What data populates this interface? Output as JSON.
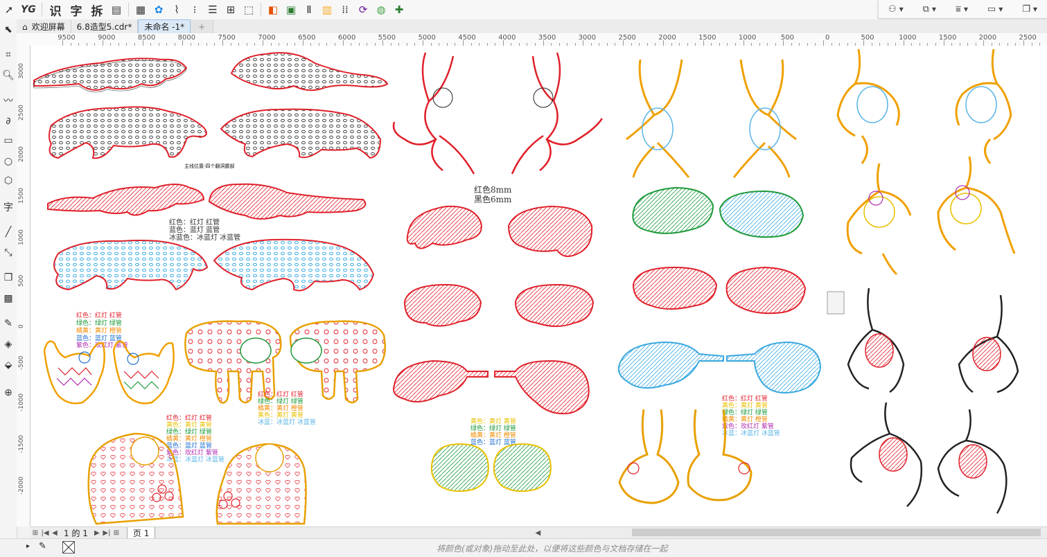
{
  "toolbar": {
    "text_icons": [
      "YG",
      "识",
      "字",
      "拆"
    ],
    "right_panel": [
      "arrange-icon",
      "group-icon",
      "align-icon",
      "display-icon",
      "window-icon"
    ]
  },
  "tabs": {
    "home_label": "欢迎屏幕",
    "doc1": "6.8造型5.cdr*",
    "doc2": "未命名 -1*"
  },
  "ruler": {
    "h_labels": [
      "9500",
      "9000",
      "8500",
      "8000",
      "7500",
      "7000",
      "6500",
      "6000",
      "5500",
      "5000",
      "4500",
      "4000",
      "3500",
      "3000",
      "2500",
      "2000",
      "1500",
      "1000",
      "500",
      "0",
      "500",
      "1000",
      "1500",
      "2000",
      "2500"
    ],
    "v_labels": [
      "3000",
      "2500",
      "2000",
      "1500",
      "1000",
      "500",
      "0",
      "-500",
      "-1000",
      "-1500",
      "-2000"
    ]
  },
  "canvas": {
    "caption_main": "主线位置-四个翻洞腹部",
    "legend_a": [
      "红色：红灯 红管",
      "蓝色：蓝灯 蓝管",
      "冰蓝色：冰蓝灯 冰蓝管"
    ],
    "legend_red_black": [
      "红色8mm",
      "黑色6mm"
    ],
    "legend_b": [
      {
        "t": "红色：红灯 红管",
        "c": "#e0202a"
      },
      {
        "t": "绿色：绿灯 绿管",
        "c": "#1e9a3a"
      },
      {
        "t": "橘黄：黄灯 橙管",
        "c": "#f08a00"
      },
      {
        "t": "蓝色：蓝灯 蓝管",
        "c": "#1e6fd0"
      },
      {
        "t": "紫色：玫红灯 紫管",
        "c": "#b02ab0"
      }
    ],
    "legend_c": [
      {
        "t": "红色：红灯 红管",
        "c": "#e0202a"
      },
      {
        "t": "黄色：黄灯 黄管",
        "c": "#e8c000"
      },
      {
        "t": "绿色：绿灯 绿管",
        "c": "#1e9a3a"
      },
      {
        "t": "橘黄：黄灯 橙管",
        "c": "#f08a00"
      },
      {
        "t": "蓝色：蓝灯 蓝管",
        "c": "#1e6fd0"
      },
      {
        "t": "紫色：玫红灯 紫管",
        "c": "#b02ab0"
      },
      {
        "t": "冰蓝：冰蓝灯 冰蓝管",
        "c": "#5ab4e6"
      }
    ],
    "legend_d": [
      {
        "t": "红色：红灯 红管",
        "c": "#e0202a"
      },
      {
        "t": "绿色：绿灯 绿管",
        "c": "#1e9a3a"
      },
      {
        "t": "橘黄：黄灯 橙管",
        "c": "#f08a00"
      },
      {
        "t": "黄色：黄灯 黄管",
        "c": "#e8c000"
      },
      {
        "t": "冰蓝：冰蓝灯 冰蓝管",
        "c": "#5ab4e6"
      }
    ],
    "legend_e": [
      {
        "t": "黄色：黄灯 黄管",
        "c": "#e8c000"
      },
      {
        "t": "绿色：绿灯 绿管",
        "c": "#1e9a3a"
      },
      {
        "t": "橘黄：黄灯 橙管",
        "c": "#f08a00"
      },
      {
        "t": "蓝色：蓝灯 蓝管",
        "c": "#1e6fd0"
      }
    ],
    "legend_f": [
      {
        "t": "红色：红灯 红管",
        "c": "#e0202a"
      },
      {
        "t": "黄色：黄灯 黄管",
        "c": "#e8c000"
      },
      {
        "t": "绿色：绿灯 绿管",
        "c": "#1e9a3a"
      },
      {
        "t": "橘黄：黄灯 橙管",
        "c": "#f08a00"
      },
      {
        "t": "紫色：玫红灯 紫管",
        "c": "#b02ab0"
      },
      {
        "t": "冰蓝：冰蓝灯 冰蓝管",
        "c": "#5ab4e6"
      }
    ]
  },
  "pagebar": {
    "page_count": "1 的 1",
    "page_tab": "页 1"
  },
  "status": {
    "hint": "将颜色(或对象)拖动至此处，以便将这些颜色与文档存储在一起"
  }
}
